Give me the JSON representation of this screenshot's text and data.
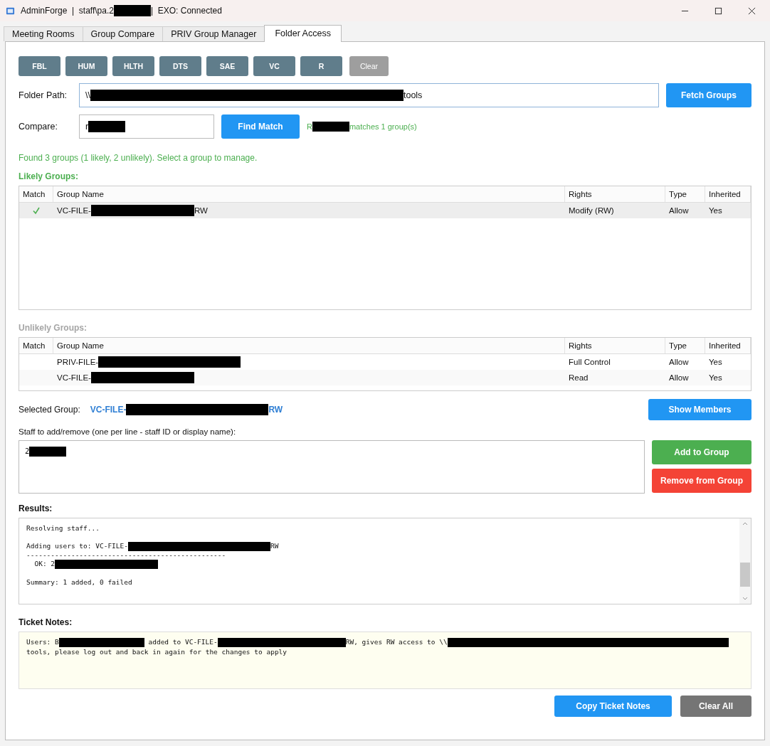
{
  "window": {
    "title": [
      "AdminForge  |  staff\\pa.2",
      {
        "redacted": true
      },
      "|  EXO: Connected"
    ]
  },
  "tabs": [
    {
      "label": "Meeting Rooms",
      "selected": false
    },
    {
      "label": "Group Compare",
      "selected": false
    },
    {
      "label": "PRIV Group Manager",
      "selected": false
    },
    {
      "label": "Folder Access",
      "selected": true
    }
  ],
  "quick_buttons": [
    {
      "label": "FBL",
      "kind": "preset"
    },
    {
      "label": "HUM",
      "kind": "preset"
    },
    {
      "label": "HLTH",
      "kind": "preset"
    },
    {
      "label": "DTS",
      "kind": "preset"
    },
    {
      "label": "SAE",
      "kind": "preset"
    },
    {
      "label": "VC",
      "kind": "preset"
    },
    {
      "label": "R",
      "kind": "preset"
    },
    {
      "label": "Clear",
      "kind": "clear"
    }
  ],
  "folder_path": {
    "label": "Folder Path:",
    "value": [
      "\\\\",
      {
        "redacted": true
      },
      "tools"
    ],
    "button": "Fetch Groups"
  },
  "compare": {
    "label": "Compare:",
    "value": [
      "r",
      {
        "redacted": true
      }
    ],
    "button": "Find Match",
    "result": [
      "R",
      {
        "redacted": true
      },
      "matches 1 group(s)"
    ]
  },
  "status": "Found 3 groups (1 likely, 2 unlikely). Select a group to manage.",
  "likely": {
    "heading": "Likely Groups:",
    "columns": [
      "Match",
      "Group Name",
      "Rights",
      "Type",
      "Inherited"
    ],
    "rows": [
      {
        "match": true,
        "name": [
          "VC-FILE-",
          {
            "redacted": true
          },
          "RW"
        ],
        "rights": "Modify (RW)",
        "type": "Allow",
        "inherited": "Yes",
        "selected": true
      }
    ]
  },
  "unlikely": {
    "heading": "Unlikely Groups:",
    "columns": [
      "Match",
      "Group Name",
      "Rights",
      "Type",
      "Inherited"
    ],
    "rows": [
      {
        "match": false,
        "name": [
          "PRIV-FILE-",
          {
            "redacted": true
          }
        ],
        "rights": "Full Control",
        "type": "Allow",
        "inherited": "Yes",
        "selected": false
      },
      {
        "match": false,
        "name": [
          "VC-FILE-",
          {
            "redacted": true
          }
        ],
        "rights": "Read",
        "type": "Allow",
        "inherited": "Yes",
        "selected": false
      }
    ]
  },
  "selected_group": {
    "label": "Selected Group:",
    "value": [
      "VC-FILE-",
      {
        "redacted": true
      },
      "RW"
    ],
    "button": "Show Members"
  },
  "staff": {
    "label": "Staff to add/remove (one per line - staff ID or display name):",
    "value": [
      "2",
      {
        "redacted": true
      }
    ],
    "add_button": "Add to Group",
    "remove_button": "Remove from Group"
  },
  "results": {
    "heading": "Results:",
    "blocks": [
      [
        [
          "Resolving staff..."
        ]
      ],
      [
        [
          "Adding users to: VC-FILE-",
          {
            "redacted": true
          },
          "RW"
        ],
        [
          "-------------------------------------------------"
        ],
        [
          "  OK: 2",
          {
            "redacted": true
          }
        ]
      ],
      [
        [
          "Summary: 1 added, 0 failed"
        ]
      ]
    ]
  },
  "ticket_notes": {
    "heading": "Ticket Notes:",
    "text": [
      "Users: B",
      {
        "redacted": true
      },
      " added to VC-FILE-",
      {
        "redacted": true
      },
      "RW, gives RW access to \\\\",
      {
        "redacted": true
      },
      "tools, please log out and back in again for the changes to apply"
    ]
  },
  "footer_buttons": [
    {
      "label": "Copy Ticket Notes",
      "kind": "primary"
    },
    {
      "label": "Clear All",
      "kind": "secondary"
    }
  ]
}
